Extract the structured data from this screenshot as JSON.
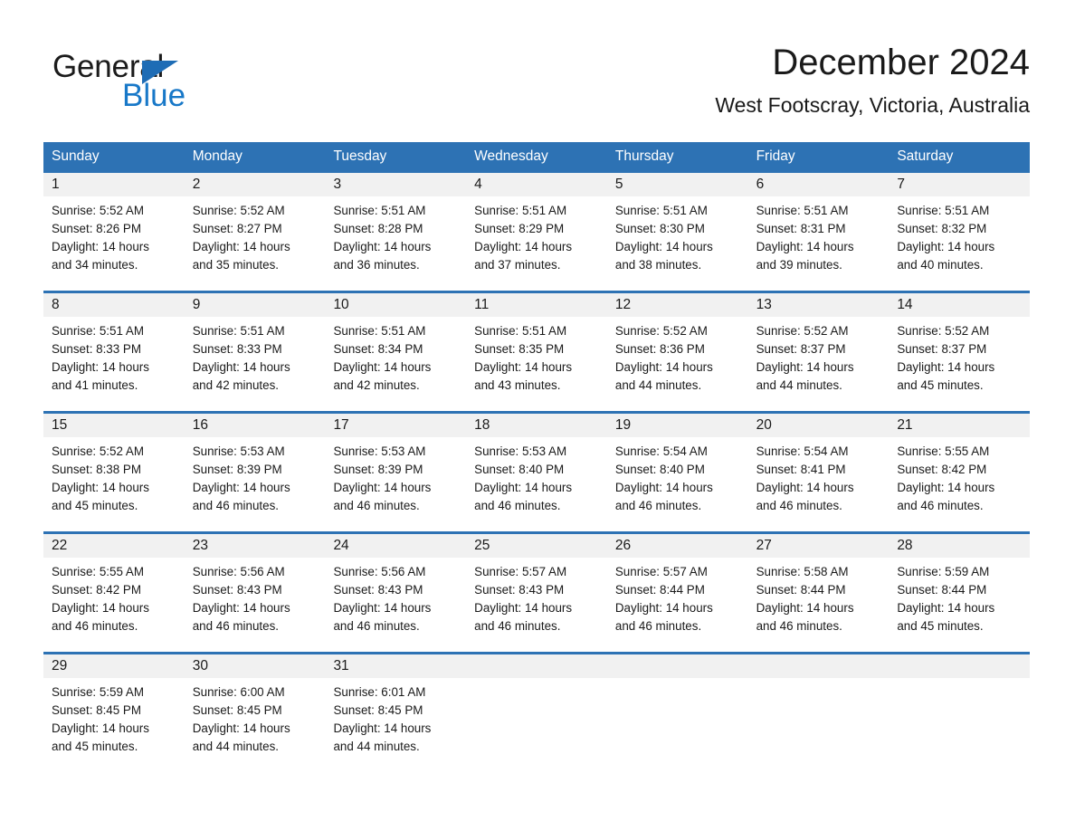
{
  "brand": {
    "name_part1": "General",
    "name_part2": "Blue",
    "triangle_color": "#1e6cb5",
    "blue_color": "#1878c8"
  },
  "header": {
    "title": "December 2024",
    "subtitle": "West Footscray, Victoria, Australia"
  },
  "theme": {
    "header_blue": "#2d72b4",
    "daynum_band": "#f1f1f1",
    "text": "#1a1a1a",
    "header_text": "#ffffff"
  },
  "weekdays": [
    "Sunday",
    "Monday",
    "Tuesday",
    "Wednesday",
    "Thursday",
    "Friday",
    "Saturday"
  ],
  "weeks": [
    {
      "days": [
        {
          "num": "1",
          "sunrise": "Sunrise: 5:52 AM",
          "sunset": "Sunset: 8:26 PM",
          "daylight1": "Daylight: 14 hours",
          "daylight2": "and 34 minutes."
        },
        {
          "num": "2",
          "sunrise": "Sunrise: 5:52 AM",
          "sunset": "Sunset: 8:27 PM",
          "daylight1": "Daylight: 14 hours",
          "daylight2": "and 35 minutes."
        },
        {
          "num": "3",
          "sunrise": "Sunrise: 5:51 AM",
          "sunset": "Sunset: 8:28 PM",
          "daylight1": "Daylight: 14 hours",
          "daylight2": "and 36 minutes."
        },
        {
          "num": "4",
          "sunrise": "Sunrise: 5:51 AM",
          "sunset": "Sunset: 8:29 PM",
          "daylight1": "Daylight: 14 hours",
          "daylight2": "and 37 minutes."
        },
        {
          "num": "5",
          "sunrise": "Sunrise: 5:51 AM",
          "sunset": "Sunset: 8:30 PM",
          "daylight1": "Daylight: 14 hours",
          "daylight2": "and 38 minutes."
        },
        {
          "num": "6",
          "sunrise": "Sunrise: 5:51 AM",
          "sunset": "Sunset: 8:31 PM",
          "daylight1": "Daylight: 14 hours",
          "daylight2": "and 39 minutes."
        },
        {
          "num": "7",
          "sunrise": "Sunrise: 5:51 AM",
          "sunset": "Sunset: 8:32 PM",
          "daylight1": "Daylight: 14 hours",
          "daylight2": "and 40 minutes."
        }
      ]
    },
    {
      "days": [
        {
          "num": "8",
          "sunrise": "Sunrise: 5:51 AM",
          "sunset": "Sunset: 8:33 PM",
          "daylight1": "Daylight: 14 hours",
          "daylight2": "and 41 minutes."
        },
        {
          "num": "9",
          "sunrise": "Sunrise: 5:51 AM",
          "sunset": "Sunset: 8:33 PM",
          "daylight1": "Daylight: 14 hours",
          "daylight2": "and 42 minutes."
        },
        {
          "num": "10",
          "sunrise": "Sunrise: 5:51 AM",
          "sunset": "Sunset: 8:34 PM",
          "daylight1": "Daylight: 14 hours",
          "daylight2": "and 42 minutes."
        },
        {
          "num": "11",
          "sunrise": "Sunrise: 5:51 AM",
          "sunset": "Sunset: 8:35 PM",
          "daylight1": "Daylight: 14 hours",
          "daylight2": "and 43 minutes."
        },
        {
          "num": "12",
          "sunrise": "Sunrise: 5:52 AM",
          "sunset": "Sunset: 8:36 PM",
          "daylight1": "Daylight: 14 hours",
          "daylight2": "and 44 minutes."
        },
        {
          "num": "13",
          "sunrise": "Sunrise: 5:52 AM",
          "sunset": "Sunset: 8:37 PM",
          "daylight1": "Daylight: 14 hours",
          "daylight2": "and 44 minutes."
        },
        {
          "num": "14",
          "sunrise": "Sunrise: 5:52 AM",
          "sunset": "Sunset: 8:37 PM",
          "daylight1": "Daylight: 14 hours",
          "daylight2": "and 45 minutes."
        }
      ]
    },
    {
      "days": [
        {
          "num": "15",
          "sunrise": "Sunrise: 5:52 AM",
          "sunset": "Sunset: 8:38 PM",
          "daylight1": "Daylight: 14 hours",
          "daylight2": "and 45 minutes."
        },
        {
          "num": "16",
          "sunrise": "Sunrise: 5:53 AM",
          "sunset": "Sunset: 8:39 PM",
          "daylight1": "Daylight: 14 hours",
          "daylight2": "and 46 minutes."
        },
        {
          "num": "17",
          "sunrise": "Sunrise: 5:53 AM",
          "sunset": "Sunset: 8:39 PM",
          "daylight1": "Daylight: 14 hours",
          "daylight2": "and 46 minutes."
        },
        {
          "num": "18",
          "sunrise": "Sunrise: 5:53 AM",
          "sunset": "Sunset: 8:40 PM",
          "daylight1": "Daylight: 14 hours",
          "daylight2": "and 46 minutes."
        },
        {
          "num": "19",
          "sunrise": "Sunrise: 5:54 AM",
          "sunset": "Sunset: 8:40 PM",
          "daylight1": "Daylight: 14 hours",
          "daylight2": "and 46 minutes."
        },
        {
          "num": "20",
          "sunrise": "Sunrise: 5:54 AM",
          "sunset": "Sunset: 8:41 PM",
          "daylight1": "Daylight: 14 hours",
          "daylight2": "and 46 minutes."
        },
        {
          "num": "21",
          "sunrise": "Sunrise: 5:55 AM",
          "sunset": "Sunset: 8:42 PM",
          "daylight1": "Daylight: 14 hours",
          "daylight2": "and 46 minutes."
        }
      ]
    },
    {
      "days": [
        {
          "num": "22",
          "sunrise": "Sunrise: 5:55 AM",
          "sunset": "Sunset: 8:42 PM",
          "daylight1": "Daylight: 14 hours",
          "daylight2": "and 46 minutes."
        },
        {
          "num": "23",
          "sunrise": "Sunrise: 5:56 AM",
          "sunset": "Sunset: 8:43 PM",
          "daylight1": "Daylight: 14 hours",
          "daylight2": "and 46 minutes."
        },
        {
          "num": "24",
          "sunrise": "Sunrise: 5:56 AM",
          "sunset": "Sunset: 8:43 PM",
          "daylight1": "Daylight: 14 hours",
          "daylight2": "and 46 minutes."
        },
        {
          "num": "25",
          "sunrise": "Sunrise: 5:57 AM",
          "sunset": "Sunset: 8:43 PM",
          "daylight1": "Daylight: 14 hours",
          "daylight2": "and 46 minutes."
        },
        {
          "num": "26",
          "sunrise": "Sunrise: 5:57 AM",
          "sunset": "Sunset: 8:44 PM",
          "daylight1": "Daylight: 14 hours",
          "daylight2": "and 46 minutes."
        },
        {
          "num": "27",
          "sunrise": "Sunrise: 5:58 AM",
          "sunset": "Sunset: 8:44 PM",
          "daylight1": "Daylight: 14 hours",
          "daylight2": "and 46 minutes."
        },
        {
          "num": "28",
          "sunrise": "Sunrise: 5:59 AM",
          "sunset": "Sunset: 8:44 PM",
          "daylight1": "Daylight: 14 hours",
          "daylight2": "and 45 minutes."
        }
      ]
    },
    {
      "days": [
        {
          "num": "29",
          "sunrise": "Sunrise: 5:59 AM",
          "sunset": "Sunset: 8:45 PM",
          "daylight1": "Daylight: 14 hours",
          "daylight2": "and 45 minutes."
        },
        {
          "num": "30",
          "sunrise": "Sunrise: 6:00 AM",
          "sunset": "Sunset: 8:45 PM",
          "daylight1": "Daylight: 14 hours",
          "daylight2": "and 44 minutes."
        },
        {
          "num": "31",
          "sunrise": "Sunrise: 6:01 AM",
          "sunset": "Sunset: 8:45 PM",
          "daylight1": "Daylight: 14 hours",
          "daylight2": "and 44 minutes."
        },
        {
          "num": "",
          "sunrise": "",
          "sunset": "",
          "daylight1": "",
          "daylight2": ""
        },
        {
          "num": "",
          "sunrise": "",
          "sunset": "",
          "daylight1": "",
          "daylight2": ""
        },
        {
          "num": "",
          "sunrise": "",
          "sunset": "",
          "daylight1": "",
          "daylight2": ""
        },
        {
          "num": "",
          "sunrise": "",
          "sunset": "",
          "daylight1": "",
          "daylight2": ""
        }
      ]
    }
  ]
}
